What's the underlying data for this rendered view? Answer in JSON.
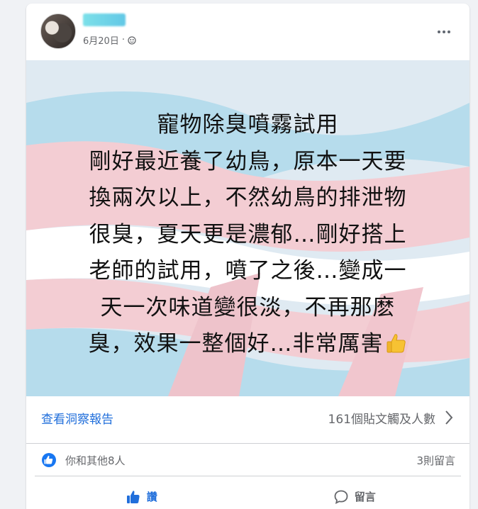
{
  "post": {
    "date": "6月20日",
    "separator": "·",
    "privacy_icon": "globe-icon",
    "more_icon": "more-horizontal-icon"
  },
  "image_text": {
    "lines": [
      "寵物除臭噴霧試用",
      "剛好最近養了幼鳥，原本一天要",
      "換兩次以上，不然幼鳥的排泄物",
      "很臭，夏天更是濃郁…剛好搭上",
      "老師的試用，噴了之後…變成一",
      "天一次味道變很淡，不再那麽",
      "臭，效果一整個好…非常厲害"
    ],
    "trailing_emoji": "thumbs-up-icon"
  },
  "insights": {
    "link_label": "查看洞察報告",
    "reach_label": "161個貼文觸及人數"
  },
  "reactions": {
    "summary": "你和其他8人",
    "comments": "3則留言"
  },
  "actions": {
    "like_label": "讚",
    "comment_label": "留言"
  },
  "colors": {
    "accent": "#216fdb",
    "secondary_text": "#65676b",
    "image_bg_blue": "#a9d8ea",
    "image_bg_pink": "#f1c6ce"
  }
}
